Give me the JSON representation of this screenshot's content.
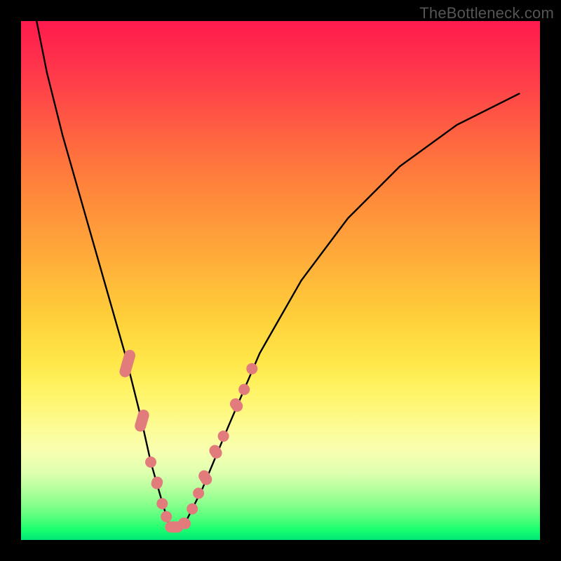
{
  "watermark": "TheBottleneck.com",
  "chart_data": {
    "type": "line",
    "title": "",
    "xlabel": "",
    "ylabel": "",
    "xlim": [
      0,
      100
    ],
    "ylim": [
      0,
      100
    ],
    "series": [
      {
        "name": "bottleneck-curve",
        "x": [
          3,
          5,
          8,
          12,
          16,
          20,
          23,
          25,
          27,
          28.5,
          30,
          32,
          35,
          40,
          46,
          54,
          63,
          73,
          84,
          96
        ],
        "values": [
          100,
          90,
          78,
          64,
          50,
          36,
          24,
          15,
          8,
          3,
          2.5,
          4,
          10,
          22,
          36,
          50,
          62,
          72,
          80,
          86
        ]
      }
    ],
    "markers": {
      "name": "highlighted-points",
      "color": "#e27b7b",
      "points": [
        {
          "x": 20.5,
          "y": 34,
          "kind": "pill",
          "angle": -74,
          "len": 40
        },
        {
          "x": 23.3,
          "y": 23,
          "kind": "pill",
          "angle": -74,
          "len": 32
        },
        {
          "x": 25.0,
          "y": 15,
          "kind": "dot"
        },
        {
          "x": 26.2,
          "y": 11,
          "kind": "pill",
          "angle": -72,
          "len": 18
        },
        {
          "x": 27.2,
          "y": 7,
          "kind": "dot"
        },
        {
          "x": 28.0,
          "y": 4.5,
          "kind": "dot"
        },
        {
          "x": 29.5,
          "y": 2.5,
          "kind": "pill",
          "angle": 0,
          "len": 26
        },
        {
          "x": 31.5,
          "y": 3.2,
          "kind": "pill",
          "angle": 18,
          "len": 18
        },
        {
          "x": 33.0,
          "y": 6,
          "kind": "dot"
        },
        {
          "x": 34.2,
          "y": 9,
          "kind": "dot"
        },
        {
          "x": 35.5,
          "y": 12,
          "kind": "pill",
          "angle": 58,
          "len": 22
        },
        {
          "x": 37.5,
          "y": 17,
          "kind": "pill",
          "angle": 58,
          "len": 20
        },
        {
          "x": 39.0,
          "y": 20,
          "kind": "dot"
        },
        {
          "x": 41.5,
          "y": 26,
          "kind": "pill",
          "angle": 55,
          "len": 20
        },
        {
          "x": 43.0,
          "y": 29,
          "kind": "dot"
        },
        {
          "x": 44.5,
          "y": 33,
          "kind": "dot"
        }
      ]
    },
    "background_gradient": {
      "top": "#ff1a4d",
      "upper_mid": "#ffad3a",
      "mid": "#fff56a",
      "lower": "#00e676"
    }
  }
}
